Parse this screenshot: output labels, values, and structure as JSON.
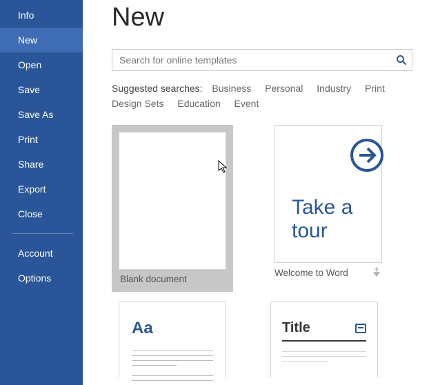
{
  "sidebar": {
    "items": [
      {
        "label": "Info",
        "active": false
      },
      {
        "label": "New",
        "active": true
      },
      {
        "label": "Open",
        "active": false
      },
      {
        "label": "Save",
        "active": false
      },
      {
        "label": "Save As",
        "active": false
      },
      {
        "label": "Print",
        "active": false
      },
      {
        "label": "Share",
        "active": false
      },
      {
        "label": "Export",
        "active": false
      },
      {
        "label": "Close",
        "active": false
      }
    ],
    "footer": [
      {
        "label": "Account"
      },
      {
        "label": "Options"
      }
    ]
  },
  "page": {
    "title": "New"
  },
  "search": {
    "placeholder": "Search for online templates",
    "value": ""
  },
  "suggested": {
    "label": "Suggested searches:",
    "links": [
      "Business",
      "Personal",
      "Industry",
      "Print",
      "Design Sets",
      "Education",
      "Event"
    ]
  },
  "templates": {
    "blank": {
      "label": "Blank document"
    },
    "tour": {
      "label": "Welcome to Word",
      "thumb_line1": "Take a",
      "thumb_line2": "tour"
    },
    "aa": {
      "thumb_text": "Aa"
    },
    "title": {
      "thumb_text": "Title"
    }
  }
}
